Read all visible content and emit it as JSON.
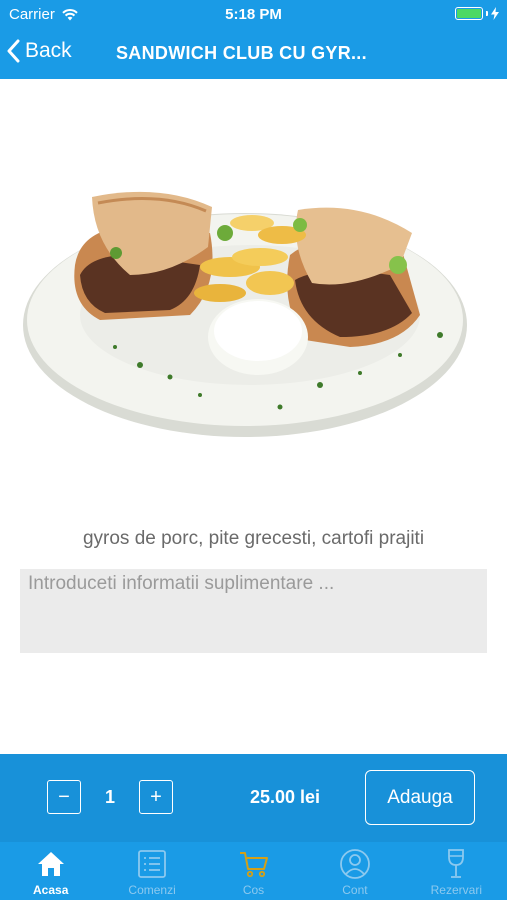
{
  "status_bar": {
    "carrier": "Carrier",
    "time": "5:18 PM",
    "battery_color": "#4cd964"
  },
  "nav": {
    "back_label": "Back",
    "title": "SANDWICH CLUB CU GYR..."
  },
  "product": {
    "image_icon": "gyros-sandwich-plate-photo",
    "description": "gyros de porc, pite grecesti, cartofi prajiti",
    "notes_placeholder": "Introduceti informatii suplimentare ...",
    "notes_value": ""
  },
  "order": {
    "minus_label": "−",
    "quantity": "1",
    "plus_label": "+",
    "price": "25.00 lei",
    "add_label": "Adauga"
  },
  "tabs": [
    {
      "label": "Acasa",
      "icon": "home-icon",
      "active": true
    },
    {
      "label": "Comenzi",
      "icon": "list-icon",
      "active": false
    },
    {
      "label": "Cos",
      "icon": "cart-icon",
      "active": false
    },
    {
      "label": "Cont",
      "icon": "user-icon",
      "active": false
    },
    {
      "label": "Rezervari",
      "icon": "wine-glass-icon",
      "active": false
    }
  ],
  "colors": {
    "primary": "#1a9be6",
    "order_bar": "#1891d9",
    "tab_inactive": "#8cc9ef",
    "cart_icon": "#d4a017"
  }
}
